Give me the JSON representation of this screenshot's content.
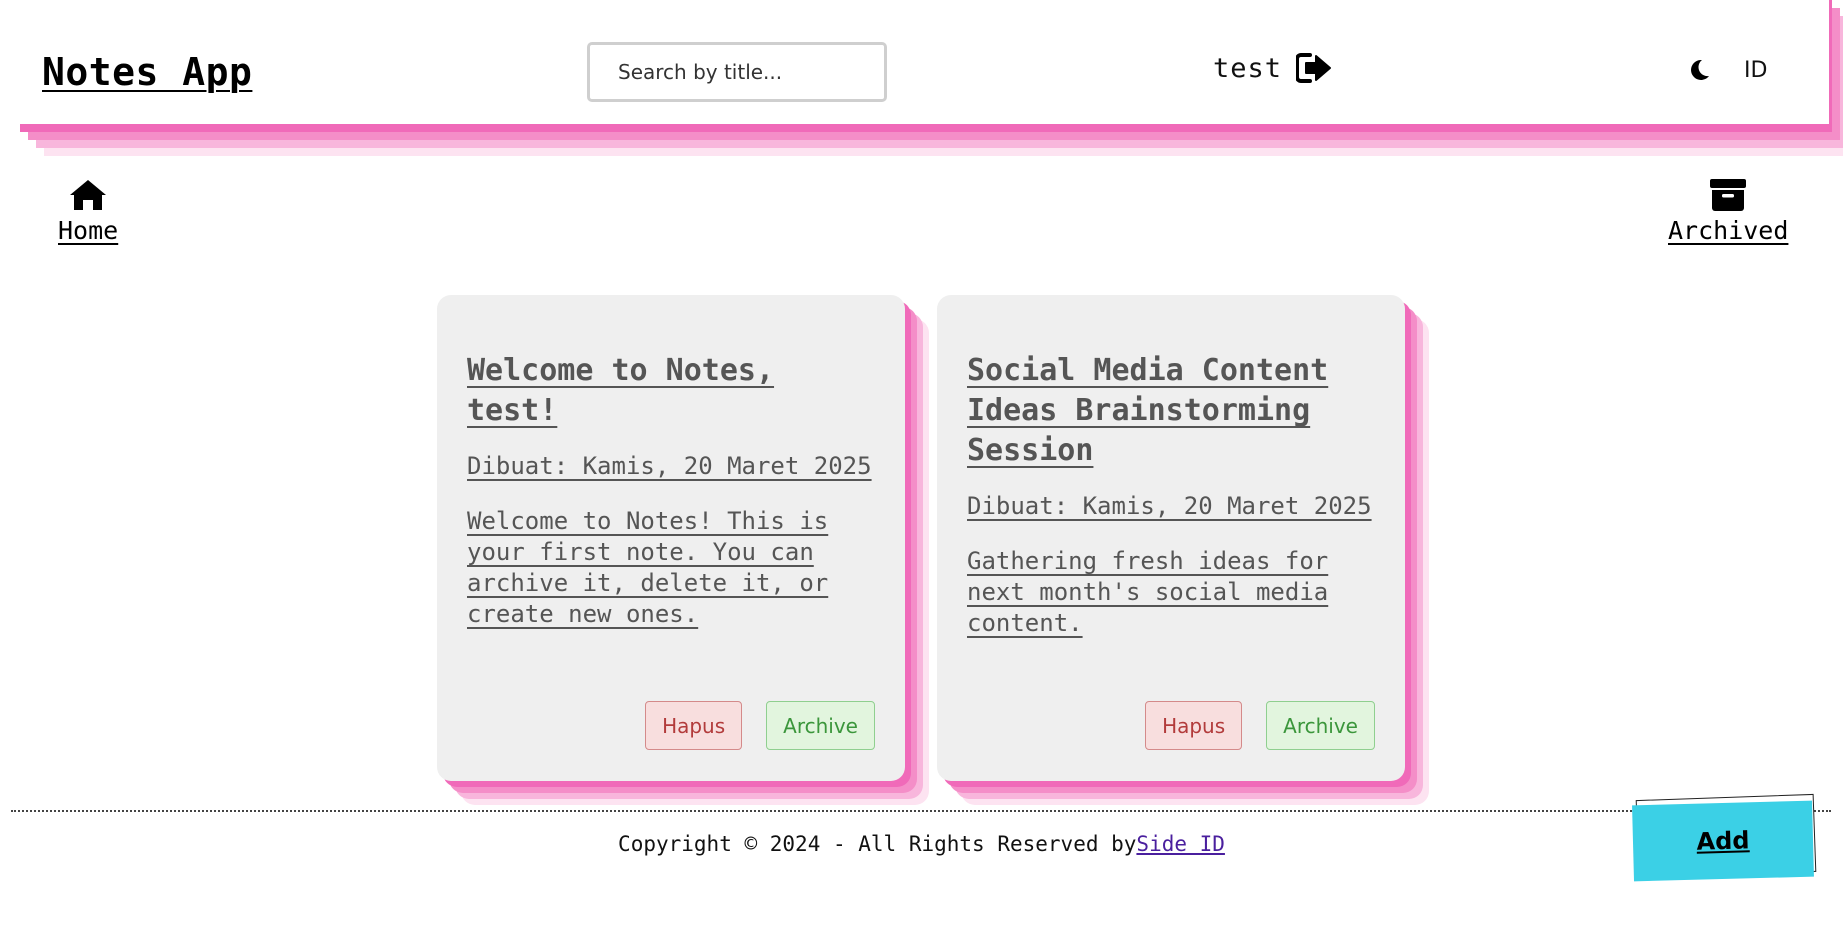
{
  "header": {
    "brand": "Notes App",
    "search_placeholder": "Search by title...",
    "user_name": "test",
    "lang_label": "ID",
    "logout_icon": "sign-out-icon",
    "theme_icon": "moon-icon"
  },
  "nav": {
    "home_label": "Home",
    "home_icon": "home-icon",
    "archived_label": "Archived",
    "archived_icon": "archive-box-icon"
  },
  "notes": [
    {
      "title": "Welcome to Notes, test!",
      "date": "Dibuat: Kamis, 20 Maret 2025",
      "body": "Welcome to Notes! This is your first note. You can archive it, delete it, or create new ones.",
      "delete_label": "Hapus",
      "archive_label": "Archive"
    },
    {
      "title": "Social Media Content Ideas Brainstorming Session",
      "date": "Dibuat: Kamis, 20 Maret 2025",
      "body": "Gathering fresh ideas for next month's social media content.",
      "delete_label": "Hapus",
      "archive_label": "Archive"
    }
  ],
  "footer": {
    "copyright": "Copyright © 2024 - All Rights Reserved by",
    "link_label": "Side ID"
  },
  "add_button_label": "Add",
  "colors": {
    "accent_pink": "#f06ab9",
    "add_cyan": "#3bd0e6",
    "card_bg": "#efefef",
    "delete_red": "#b23b3b",
    "archive_green": "#3b963b"
  }
}
